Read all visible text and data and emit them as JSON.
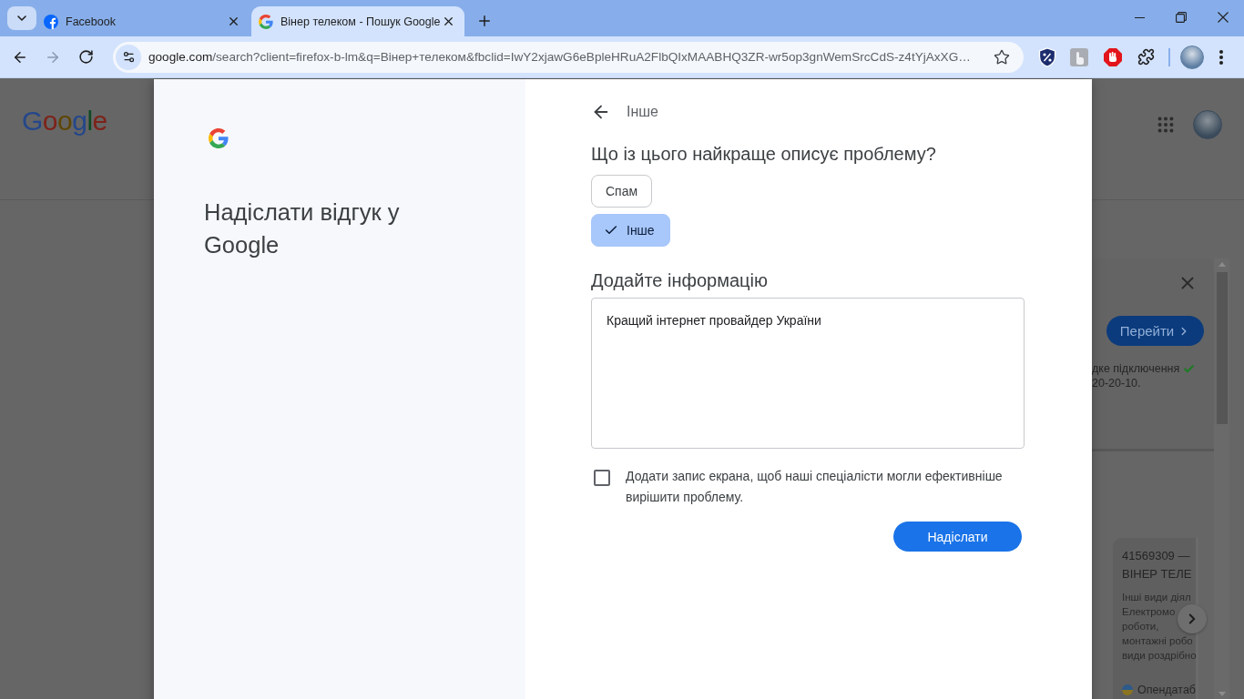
{
  "browser": {
    "tabs": [
      {
        "kind": "facebook",
        "title": "Facebook",
        "selected": false
      },
      {
        "kind": "google",
        "title": "Вінер телеком - Пошук Google",
        "selected": true
      }
    ],
    "forward_disabled": true,
    "address_bar": {
      "domain": "google.com",
      "path": "/search?client=firefox-b-lm&q=Вінер+телеком&fbclid=IwY2xjawG6eBpleHRuA2FlbQIxMAABHQ3ZR-wr5op3gnWemSrcCdS-z4tYjAxXG…"
    }
  },
  "results_page": {
    "logo": "Google",
    "promo": {
      "button": "Перейти",
      "lines": [
        {
          "text": "дке підключення",
          "checkmark": true
        },
        {
          "text": "20-20-10.",
          "checkmark": false
        }
      ]
    },
    "company_card": {
      "title_lines": [
        "41569309 —",
        "ВІНЕР ТЕЛЕ"
      ],
      "description_lines": [
        "Інші види діял",
        "Електромо",
        "роботи,",
        "монтажні робо",
        "види роздрібно"
      ],
      "source": "Опендатаб"
    }
  },
  "feedback_dialog": {
    "title": "Надіслати відгук у Google",
    "back_label": "Інше",
    "question": "Що із цього найкраще описує проблему?",
    "options": [
      {
        "label": "Спам",
        "selected": false
      },
      {
        "label": "Інше",
        "selected": true
      }
    ],
    "details_heading": "Додайте інформацію",
    "details_value": "Кращий інтернет провайдер України",
    "screenshot_option": {
      "label": "Додати запис екрана, щоб наші спеціалісти могли ефективніше вирішити проблему.",
      "checked": false
    },
    "submit_label": "Надіслати"
  }
}
